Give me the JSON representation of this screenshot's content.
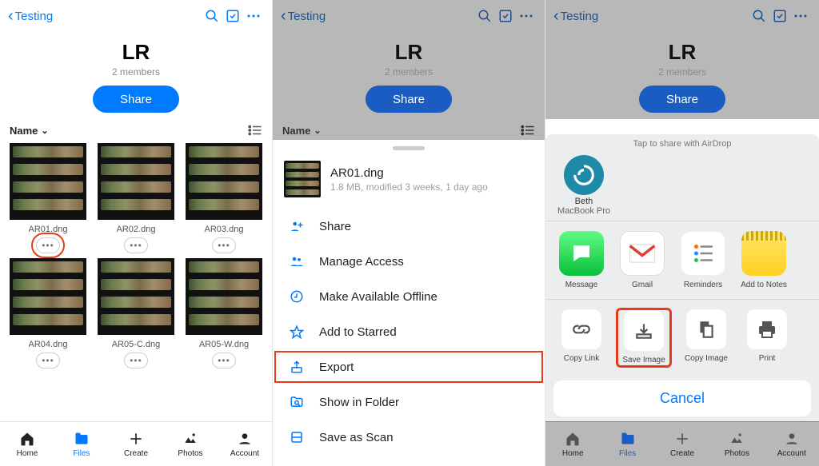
{
  "nav": {
    "back_label": "Testing"
  },
  "header": {
    "title": "LR",
    "subtitle": "2 members",
    "share_label": "Share"
  },
  "sort": {
    "label": "Name"
  },
  "files": [
    {
      "name": "AR01.dng"
    },
    {
      "name": "AR02.dng"
    },
    {
      "name": "AR03.dng"
    },
    {
      "name": "AR04.dng"
    },
    {
      "name": "AR05-C.dng"
    },
    {
      "name": "AR05-W.dng"
    }
  ],
  "tabs": {
    "home": "Home",
    "files": "Files",
    "create": "Create",
    "photos": "Photos",
    "account": "Account"
  },
  "file_sheet": {
    "name": "AR01.dng",
    "meta": "1.8 MB, modified 3 weeks, 1 day ago",
    "items": {
      "share": "Share",
      "manage": "Manage Access",
      "offline": "Make Available Offline",
      "starred": "Add to Starred",
      "export": "Export",
      "showfolder": "Show in Folder",
      "savescan": "Save as Scan"
    }
  },
  "share_sheet": {
    "caption": "Tap to share with AirDrop",
    "airdrop": {
      "name": "Beth",
      "device": "MacBook Pro"
    },
    "apps": {
      "message": "Message",
      "gmail": "Gmail",
      "reminders": "Reminders",
      "notes": "Add to Notes"
    },
    "ops": {
      "copylink": "Copy Link",
      "saveimage": "Save Image",
      "copyimage": "Copy Image",
      "print": "Print"
    },
    "cancel": "Cancel"
  }
}
